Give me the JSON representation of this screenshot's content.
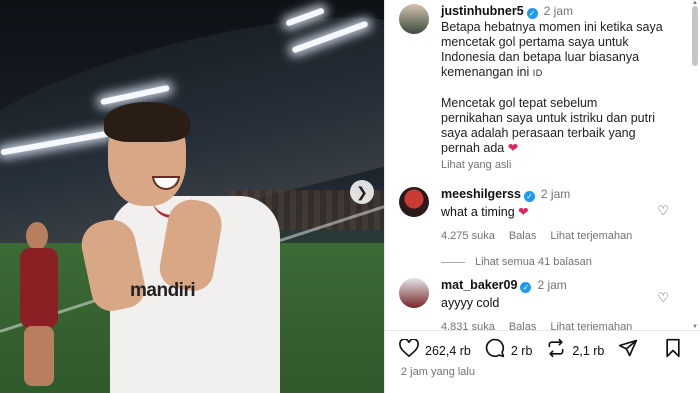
{
  "post": {
    "author": "justinhubner5",
    "time": "2 jam",
    "caption_p1_l1": "Betapa hebatnya momen ini ketika saya",
    "caption_p1_l2": "mencetak gol pertama saya untuk",
    "caption_p1_l3": "Indonesia dan betapa luar biasanya",
    "caption_p1_l4": "kemenangan ini",
    "caption_id_flag": "ID",
    "caption_p2_l1": "Mencetak gol tepat sebelum",
    "caption_p2_l2": "pernikahan saya untuk istriku dan putri",
    "caption_p2_l3": "saya adalah perasaan terbaik yang",
    "caption_p2_l4": "pernah ada",
    "see_original": "Lihat yang asli"
  },
  "photo": {
    "sponsor_text": "mandiri"
  },
  "comments": [
    {
      "user": "meeshilgerss",
      "time": "2 jam",
      "text": "what a timing",
      "likes": "4.275 suka",
      "reply": "Balas",
      "translate": "Lihat terjemahan"
    },
    {
      "user": "mat_baker09",
      "time": "2 jam",
      "text": "ayyyy cold",
      "likes": "4.831 suka",
      "reply": "Balas",
      "translate": "Lihat terjemahan"
    }
  ],
  "replies_link": "Lihat semua 41 balasan",
  "actions": {
    "likes": "262,4 rb",
    "comments": "2 rb",
    "reposts": "2,1 rb"
  },
  "timestamp": "2 jam yang lalu",
  "icons": [
    "heart-icon",
    "comment-icon",
    "repost-icon",
    "share-icon",
    "bookmark-icon",
    "verified-icon",
    "next-arrow-icon"
  ]
}
